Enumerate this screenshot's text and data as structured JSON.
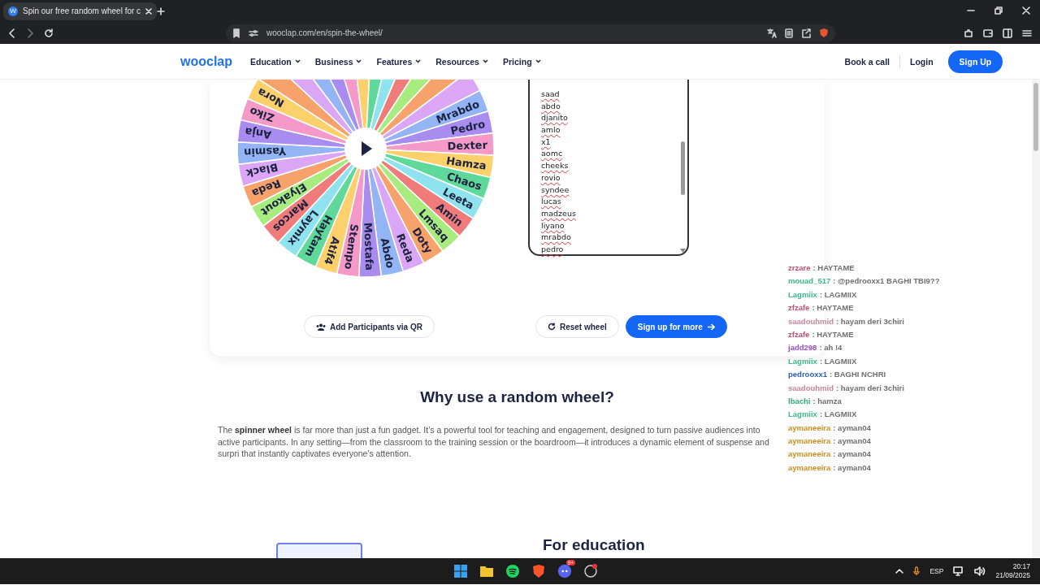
{
  "browser": {
    "favicon_letter": "W",
    "tab_title": "Spin our free random wheel for c",
    "url": "wooclap.com/en/spin-the-wheel/"
  },
  "nav": {
    "logo": "wooclap",
    "menus": [
      "Education",
      "Business",
      "Features",
      "Resources",
      "Pricing"
    ],
    "book_call": "Book a call",
    "login": "Login",
    "signup": "Sign Up"
  },
  "wheel": {
    "labels": [
      "Mrabdo",
      "Pedro",
      "Dexter",
      "Hamza",
      "Chaos",
      "Leeta",
      "Amin",
      "Lmsaq",
      "Doty",
      "Reda",
      "Abdo",
      "Mostafa",
      "Stempo",
      "Atif4",
      "Haytam",
      "Laymix",
      "Marcos",
      "Elyakout",
      "Reda",
      "Black",
      "Yasmin",
      "Anja",
      "Ziko",
      "Nora"
    ]
  },
  "participants": [
    "saad",
    "abdo",
    "djanito",
    "amlo",
    "x1",
    "aomc",
    "cheeks",
    "rovio",
    "syndee",
    "lucas",
    "madzeus",
    "liyano",
    "mrabdo",
    "pedro"
  ],
  "buttons": {
    "qr": "Add Participants via QR",
    "reset": "Reset wheel",
    "signup_more": "Sign up for more"
  },
  "why": {
    "title": "Why use a random wheel?",
    "text": "The **spinner wheel** is far more than just a fun gadget. It’s a powerful tool for teaching and engagement, designed to turn passive audiences into active participants. In any setting—from the classroom to the training session or the boardroom—it introduces a dynamic element of suspense and surpri that instantly captivates everyone's attention."
  },
  "education": {
    "title": "For education"
  },
  "chat": [
    {
      "user": "zrzare",
      "color": "#c0506e",
      "message": ": HAYTAME"
    },
    {
      "user": "mouad_517",
      "color": "#3fb88a",
      "message": ": @pedrooxx1 BAGHI TBI9??"
    },
    {
      "user": "Lagmiix",
      "color": "#3fb88a",
      "message": ": LAGMIIX"
    },
    {
      "user": "zfzafe",
      "color": "#c0506e",
      "message": ": HAYTAME"
    },
    {
      "user": "saadouhmid",
      "color": "#c9879f",
      "message": ": hayam deri 3chiri"
    },
    {
      "user": "zfzafe",
      "color": "#c0506e",
      "message": ": HAYTAME"
    },
    {
      "user": "jadd298",
      "color": "#9b4fd0",
      "message": ": ah !4"
    },
    {
      "user": "Lagmiix",
      "color": "#3fb88a",
      "message": ": LAGMIIX"
    },
    {
      "user": "pedrooxx1",
      "color": "#2f5fb0",
      "message": ": BAGHI NCHRI"
    },
    {
      "user": "saadouhmid",
      "color": "#c9879f",
      "message": ": hayam deri 3chiri"
    },
    {
      "user": "lbachi",
      "color": "#2fae7a",
      "message": ": hamza"
    },
    {
      "user": "Lagmiix",
      "color": "#3fb88a",
      "message": ": LAGMIIX"
    },
    {
      "user": "aymaneeira",
      "color": "#d08e1e",
      "message": ": ayman04"
    },
    {
      "user": "aymaneeira",
      "color": "#d08e1e",
      "message": ": ayman04"
    },
    {
      "user": "aymaneeira",
      "color": "#d08e1e",
      "message": ": ayman04"
    },
    {
      "user": "aymaneeira",
      "color": "#d08e1e",
      "message": ": ayman04"
    }
  ],
  "taskbar": {
    "discord_badge": "9+",
    "language": "ESP",
    "time": "20:17",
    "date": "21/09/2025"
  }
}
